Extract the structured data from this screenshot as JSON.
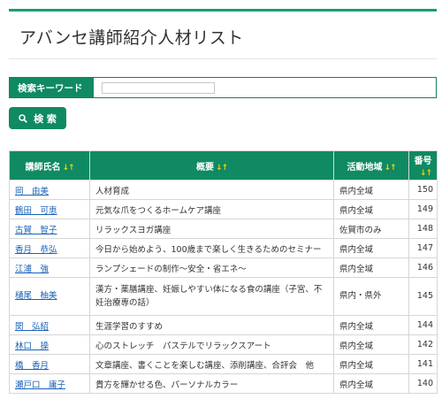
{
  "page": {
    "title": "アバンセ講師紹介人材リスト"
  },
  "search": {
    "label": "検索キーワード",
    "value": "",
    "button_label": "検 索"
  },
  "table": {
    "headers": {
      "name": "講師氏名",
      "summary": "概要",
      "area": "活動地域",
      "number": "番号",
      "sort_arrows": "↓↑"
    },
    "rows": [
      {
        "name": "岡　由美",
        "summary": "人材育成",
        "area": "県内全域",
        "number": "150"
      },
      {
        "name": "鶴田　可恵",
        "summary": "元気な爪をつくるホームケア講座",
        "area": "県内全域",
        "number": "149"
      },
      {
        "name": "古賀　智子",
        "summary": "リラックスヨガ講座",
        "area": "佐賀市のみ",
        "number": "148"
      },
      {
        "name": "香月　恭弘",
        "summary": "今日から始めよう、100歳まで楽しく生きるためのセミナー",
        "area": "県内全域",
        "number": "147"
      },
      {
        "name": "江浦　強",
        "summary": "ランプシェードの制作～安全・省エネ～",
        "area": "県内全域",
        "number": "146"
      },
      {
        "name": "樋尾　柚美",
        "summary": "漢方・薬膳講座、妊娠しやすい体になる食の講座（子宮、不妊治療専の話）",
        "area": "県内・県外",
        "number": "145"
      },
      {
        "name": "関　弘紹",
        "summary": "生涯学習のすすめ",
        "area": "県内全域",
        "number": "144"
      },
      {
        "name": "林口　操",
        "summary": "心のストレッチ　パステルでリラックスアート",
        "area": "県内全域",
        "number": "142"
      },
      {
        "name": "橋　香月",
        "summary": "文章講座、書くことを楽しむ講座、添削講座、合評会　他",
        "area": "県内全域",
        "number": "141"
      },
      {
        "name": "瀬戸口　庸子",
        "summary": "貴方を輝かせる色、パーソナルカラー",
        "area": "県内全域",
        "number": "140"
      }
    ]
  },
  "colors": {
    "accent": "#0f8a63",
    "link": "#1a63b8",
    "sort_arrow": "#f5d100"
  }
}
